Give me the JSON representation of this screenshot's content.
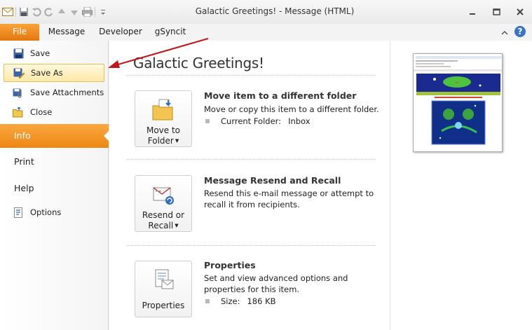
{
  "window": {
    "title": "Galactic Greetings!  -  Message (HTML)"
  },
  "ribbon": {
    "tabs": [
      {
        "label": "File",
        "active": true
      },
      {
        "label": "Message"
      },
      {
        "label": "Developer"
      },
      {
        "label": "gSyncit"
      }
    ]
  },
  "backstage_nav": {
    "commands": [
      {
        "label": "Save",
        "icon": "save-icon"
      },
      {
        "label": "Save As",
        "icon": "save-as-icon",
        "highlighted": true
      },
      {
        "label": "Save Attachments",
        "icon": "attachments-icon"
      },
      {
        "label": "Close",
        "icon": "close-folder-icon"
      }
    ],
    "info_label": "Info",
    "print_label": "Print",
    "help_label": "Help",
    "options_label": "Options"
  },
  "info": {
    "title": "Galactic Greetings!",
    "sections": [
      {
        "button_line1": "Move to",
        "button_line2": "Folder",
        "heading": "Move item to a different folder",
        "description": "Move or copy this item to a different folder.",
        "prop_label": "Current Folder:",
        "prop_value": "Inbox"
      },
      {
        "button_line1": "Resend or",
        "button_line2": "Recall",
        "heading": "Message Resend and Recall",
        "description": "Resend this e-mail message or attempt to recall it from recipients."
      },
      {
        "button_line1": "Properties",
        "heading": "Properties",
        "description": "Set and view advanced options and properties for this item.",
        "prop_label": "Size:",
        "prop_value": "186 KB"
      }
    ]
  },
  "colors": {
    "accent_orange": "#f29a2e",
    "annotation_arrow": "#c0191c"
  }
}
